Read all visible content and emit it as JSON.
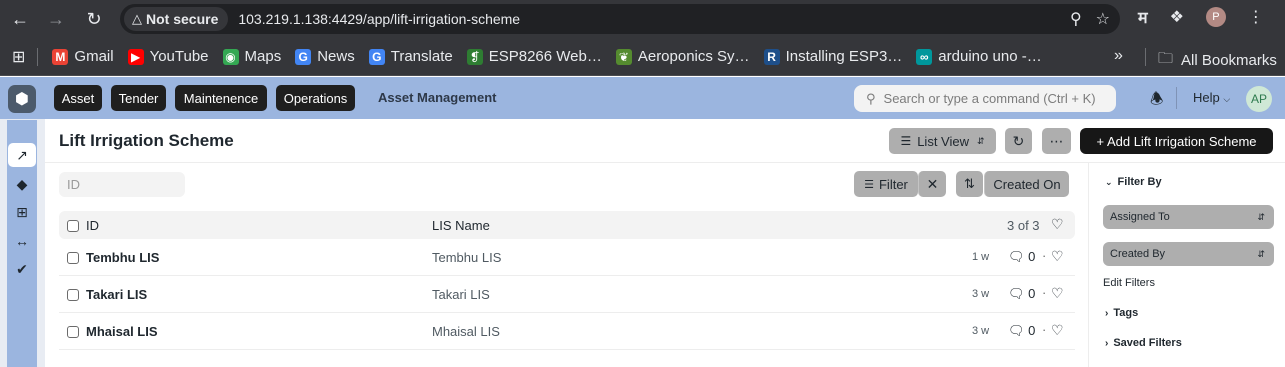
{
  "browser": {
    "security_label": "Not secure",
    "url": "103.219.1.138:4429/app/lift-irrigation-scheme",
    "profile_initial": "P",
    "bookmarks": [
      {
        "label": "Gmail",
        "icon": "gmail-icon",
        "color": "#ea4335"
      },
      {
        "label": "YouTube",
        "icon": "youtube-icon",
        "color": "#ff0000"
      },
      {
        "label": "Maps",
        "icon": "maps-icon",
        "color": "#34a853"
      },
      {
        "label": "News",
        "icon": "news-icon",
        "color": "#4285f4"
      },
      {
        "label": "Translate",
        "icon": "translate-icon",
        "color": "#4285f4"
      },
      {
        "label": "ESP8266 Web…",
        "icon": "esp-icon",
        "color": "#2e7d32"
      },
      {
        "label": "Aeroponics Sy…",
        "icon": "leaf-icon",
        "color": "#558b2f"
      },
      {
        "label": "Installing ESP3…",
        "icon": "r-icon",
        "color": "#1e4f8a"
      },
      {
        "label": "arduino uno -…",
        "icon": "arduino-icon",
        "color": "#00979c"
      }
    ],
    "bookmarks_overflow": "»",
    "all_bookmarks": "All Bookmarks"
  },
  "navbar": {
    "menu": [
      "Asset",
      "Tender",
      "Maintenence",
      "Operations"
    ],
    "app_title": "Asset Management",
    "search_placeholder": "Search or type a command (Ctrl + K)",
    "help_label": "Help",
    "user_initials": "AP",
    "bg_color": "#9bb5df"
  },
  "page": {
    "title": "Lift Irrigation Scheme",
    "list_view_label": "List View",
    "add_button_label": "+ Add Lift Irrigation Scheme"
  },
  "list": {
    "id_filter_placeholder": "ID",
    "filter_label": "Filter",
    "sort_label": "Created On",
    "columns": {
      "id": "ID",
      "lis_name": "LIS Name"
    },
    "count_label": "3 of 3",
    "rows": [
      {
        "id": "Tembhu LIS",
        "lis_name": "Tembhu LIS",
        "modified": "1 w",
        "comments": "0"
      },
      {
        "id": "Takari LIS",
        "lis_name": "Takari LIS",
        "modified": "3 w",
        "comments": "0"
      },
      {
        "id": "Mhaisal LIS",
        "lis_name": "Mhaisal LIS",
        "modified": "3 w",
        "comments": "0"
      }
    ]
  },
  "filter_sidebar": {
    "heading": "Filter By",
    "assigned_to": "Assigned To",
    "created_by": "Created By",
    "edit_filters": "Edit Filters",
    "tags": "Tags",
    "saved_filters": "Saved Filters"
  }
}
